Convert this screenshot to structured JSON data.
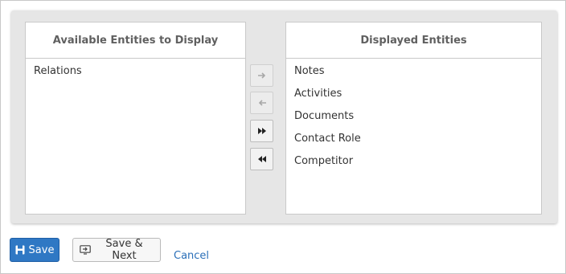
{
  "available": {
    "title": "Available Entities to Display",
    "items": [
      "Relations"
    ]
  },
  "displayed": {
    "title": "Displayed Entities",
    "items": [
      "Notes",
      "Activities",
      "Documents",
      "Contact Role",
      "Competitor"
    ]
  },
  "move_buttons": {
    "move_right_icon": "arrow-right-icon",
    "move_left_icon": "arrow-left-icon",
    "move_all_right_icon": "double-arrow-right-icon",
    "move_all_left_icon": "double-arrow-left-icon"
  },
  "actions": {
    "save_label": "Save",
    "save_next_label": "Save & Next",
    "cancel_label": "Cancel"
  },
  "colors": {
    "primary": "#2f78c4",
    "link": "#2a6fb8",
    "shuttle_bg": "#e6e6e6"
  }
}
